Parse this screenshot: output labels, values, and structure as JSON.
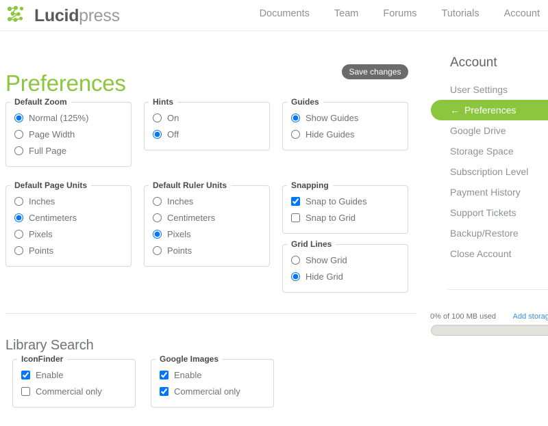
{
  "header": {
    "logo_text_bold": "Lucid",
    "logo_text_light": "press",
    "logo_icon": "lucid-dots-logo",
    "nav": [
      {
        "label": "Documents",
        "name": "nav-documents"
      },
      {
        "label": "Team",
        "name": "nav-team"
      },
      {
        "label": "Forums",
        "name": "nav-forums"
      },
      {
        "label": "Tutorials",
        "name": "nav-tutorials"
      },
      {
        "label": "Account",
        "name": "nav-account"
      }
    ]
  },
  "main": {
    "page_title": "Preferences",
    "save_label": "Save changes",
    "library_search_title": "Library Search",
    "fieldsets": [
      {
        "legend": "Default Zoom",
        "type": "radio",
        "options": [
          {
            "label": "Normal (125%)",
            "checked": true
          },
          {
            "label": "Page Width",
            "checked": false
          },
          {
            "label": "Full Page",
            "checked": false
          }
        ]
      },
      {
        "legend": "Hints",
        "type": "radio",
        "options": [
          {
            "label": "On",
            "checked": false
          },
          {
            "label": "Off",
            "checked": true
          }
        ]
      },
      {
        "legend": "Guides",
        "type": "radio",
        "options": [
          {
            "label": "Show Guides",
            "checked": true
          },
          {
            "label": "Hide Guides",
            "checked": false
          }
        ]
      },
      {
        "legend": "Default Page Units",
        "type": "radio",
        "options": [
          {
            "label": "Inches",
            "checked": false
          },
          {
            "label": "Centimeters",
            "checked": true
          },
          {
            "label": "Pixels",
            "checked": false
          },
          {
            "label": "Points",
            "checked": false
          }
        ]
      },
      {
        "legend": "Default Ruler Units",
        "type": "radio",
        "options": [
          {
            "label": "Inches",
            "checked": false
          },
          {
            "label": "Centimeters",
            "checked": false
          },
          {
            "label": "Pixels",
            "checked": true
          },
          {
            "label": "Points",
            "checked": false
          }
        ]
      },
      {
        "legend": "Snapping",
        "type": "checkbox",
        "options": [
          {
            "label": "Snap to Guides",
            "checked": true
          },
          {
            "label": "Snap to Grid",
            "checked": false
          }
        ]
      },
      {
        "legend": "Grid Lines",
        "type": "radio",
        "options": [
          {
            "label": "Show Grid",
            "checked": false
          },
          {
            "label": "Hide Grid",
            "checked": true
          }
        ]
      },
      {
        "legend": "IconFinder",
        "type": "checkbox",
        "options": [
          {
            "label": "Enable",
            "checked": true
          },
          {
            "label": "Commercial only",
            "checked": false
          }
        ]
      },
      {
        "legend": "Google Images",
        "type": "checkbox",
        "options": [
          {
            "label": "Enable",
            "checked": true
          },
          {
            "label": "Commercial only",
            "checked": true
          }
        ]
      }
    ]
  },
  "sidebar": {
    "title": "Account",
    "active_arrow_icon": "arrow-left-icon",
    "items": [
      {
        "label": "User Settings",
        "name": "sidebar-item-user-settings",
        "active": false
      },
      {
        "label": "Preferences",
        "name": "sidebar-item-preferences",
        "active": true
      },
      {
        "label": "Google Drive",
        "name": "sidebar-item-google-drive",
        "active": false
      },
      {
        "label": "Storage Space",
        "name": "sidebar-item-storage-space",
        "active": false
      },
      {
        "label": "Subscription Level",
        "name": "sidebar-item-subscription-level",
        "active": false
      },
      {
        "label": "Payment History",
        "name": "sidebar-item-payment-history",
        "active": false
      },
      {
        "label": "Support Tickets",
        "name": "sidebar-item-support-tickets",
        "active": false
      },
      {
        "label": "Backup/Restore",
        "name": "sidebar-item-backup-restore",
        "active": false
      },
      {
        "label": "Close Account",
        "name": "sidebar-item-close-account",
        "active": false
      }
    ],
    "storage": {
      "label": "0% of 100 MB used",
      "add_storage_label": "Add storage",
      "percent_used": 0
    }
  },
  "colors": {
    "brand_green": "#8cc63e",
    "link_blue": "#3b8fd4",
    "text_gray": "#8d9196",
    "save_button_gray": "#6b6b6b"
  }
}
